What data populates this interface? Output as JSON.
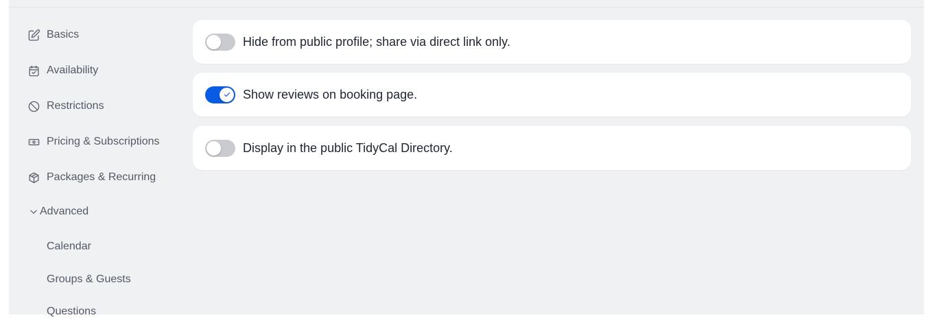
{
  "sidebar": {
    "items": [
      {
        "label": "Basics",
        "icon": "edit-icon"
      },
      {
        "label": "Availability",
        "icon": "calendar-check-icon"
      },
      {
        "label": "Restrictions",
        "icon": "ban-icon"
      },
      {
        "label": "Pricing & Subscriptions",
        "icon": "cash-icon"
      },
      {
        "label": "Packages & Recurring",
        "icon": "package-icon"
      }
    ],
    "group": {
      "label": "Advanced",
      "expanded": true,
      "icon": "chevron-down-icon",
      "subitems": [
        {
          "label": "Calendar"
        },
        {
          "label": "Groups & Guests"
        },
        {
          "label": "Questions"
        }
      ]
    }
  },
  "settings": [
    {
      "label": "Hide from public profile; share via direct link only.",
      "enabled": false
    },
    {
      "label": "Show reviews on booking page.",
      "enabled": true
    },
    {
      "label": "Display in the public TidyCal Directory.",
      "enabled": false
    }
  ],
  "colors": {
    "accent": "#0a5be4",
    "toggle_off": "#c9cbd0",
    "background": "#f0f1f3"
  }
}
